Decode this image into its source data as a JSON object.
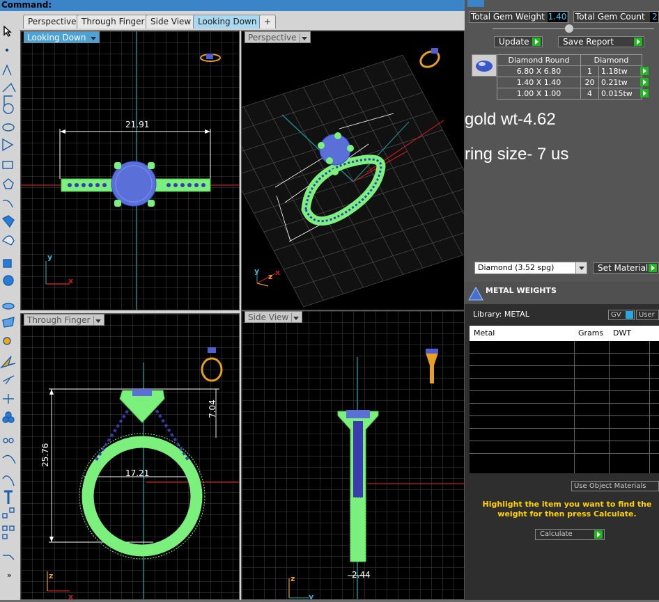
{
  "command": {
    "label": "Command:"
  },
  "tabs": [
    {
      "label": "Perspective"
    },
    {
      "label": "Through Finger"
    },
    {
      "label": "Side View"
    },
    {
      "label": "Looking Down"
    },
    {
      "label": "+"
    }
  ],
  "viewports": {
    "top_left": {
      "name": "Looking Down",
      "dim": "21.91"
    },
    "top_right": {
      "name": "Perspective"
    },
    "bottom_left": {
      "name": "Through Finger",
      "dim_height": "25.76",
      "dim_width": "17.21",
      "dim_head": "7.04"
    },
    "bottom_right": {
      "name": "Side View",
      "dim": "2.44"
    },
    "axes": {
      "x": "x",
      "y": "y",
      "z": "z"
    }
  },
  "gem_panel": {
    "total_weight_label": "Total Gem Weight",
    "total_weight_value": "1.40",
    "total_count_label": "Total Gem Count",
    "total_count_value": "2",
    "update_label": "Update",
    "save_report_label": "Save Report",
    "table_headers": [
      "Diamond Round",
      "Diamond"
    ],
    "rows": [
      {
        "size": "6.80 X 6.80",
        "count": "1",
        "tw": "1.18tw"
      },
      {
        "size": "1.40 X 1.40",
        "count": "20",
        "tw": "0.21tw"
      },
      {
        "size": "1.00 X 1.00",
        "count": "4",
        "tw": "0.015tw"
      }
    ]
  },
  "notes": {
    "gold": "gold wt-4.62",
    "ring": "ring size- 7 us"
  },
  "material": {
    "select_value": "Diamond     (3.52 spg)",
    "set_label": "Set Material"
  },
  "metal_weights": {
    "title": "METAL WEIGHTS",
    "library_label": "Library: METAL",
    "gv_label": "GV",
    "user_label": "User",
    "cols": [
      "Metal",
      "Grams",
      "DWT"
    ],
    "use_object_label": "Use Object Materials",
    "hint": "Highlight the item you want to find the weight for then press Calculate.",
    "calculate_label": "Calculate"
  },
  "colors": {
    "accent": "#4aa3d8",
    "ring": "#7cf07c",
    "gem": "#5b6fd8",
    "hint": "#ffd200"
  }
}
